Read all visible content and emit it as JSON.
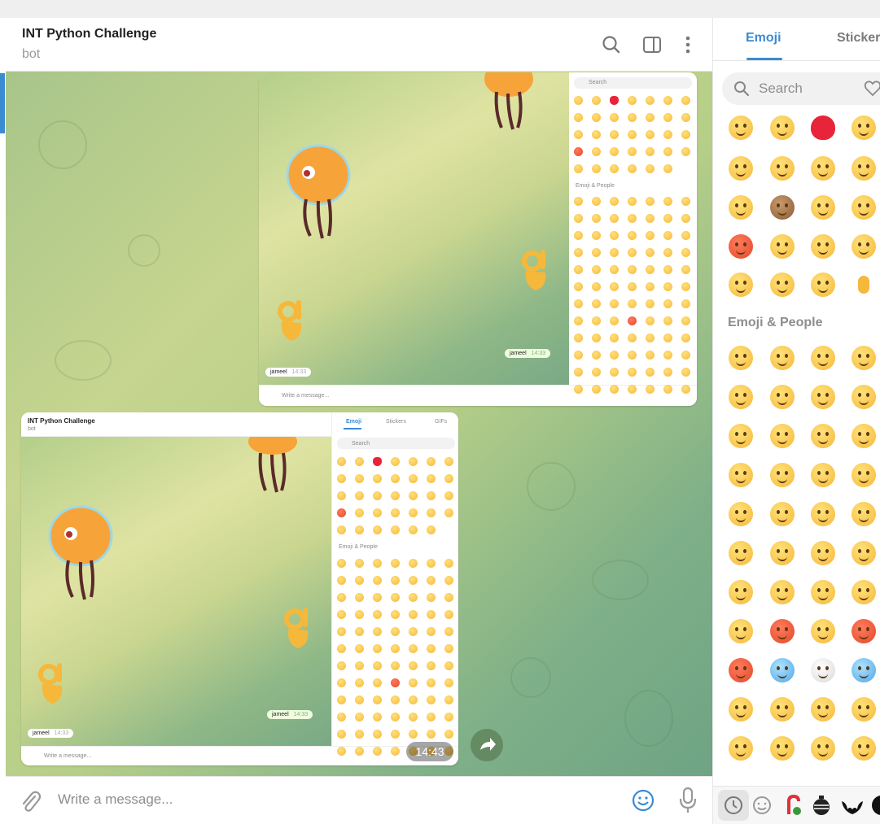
{
  "chat": {
    "title": "INT Python Challenge",
    "subtitle": "bot",
    "compose_placeholder": "Write a message...",
    "overlay_time": "14:43"
  },
  "icons": {
    "search": "search-icon",
    "sidebar_toggle": "sidebar-toggle-icon",
    "more": "more-vertical-icon",
    "attach": "paperclip-icon",
    "emoji": "smile-icon",
    "mic": "microphone-icon",
    "forward": "forward-arrow-icon"
  },
  "screenshot1": {
    "search_placeholder": "Search",
    "section": "Emoji & People",
    "msg_in": "jameel",
    "msg_in_time": "14:33",
    "msg_out": "jameel",
    "msg_out_time": "14:33",
    "compose_placeholder": "Write a message..."
  },
  "screenshot2": {
    "title": "INT Python Challenge",
    "subtitle": "bot",
    "tabs": [
      "Emoji",
      "Stickers",
      "GIFs"
    ],
    "search_placeholder": "Search",
    "section": "Emoji & People",
    "msg_in": "jameel",
    "msg_in_time": "14:33",
    "msg_out": "jameel",
    "msg_out_time": "14:33",
    "compose_placeholder": "Write a message..."
  },
  "emoji_panel": {
    "tabs": [
      "Emoji",
      "Stickers"
    ],
    "active_tab": "Emoji",
    "search_placeholder": "Search",
    "section_label": "Emoji & People",
    "accent": "#3a8bd1"
  }
}
